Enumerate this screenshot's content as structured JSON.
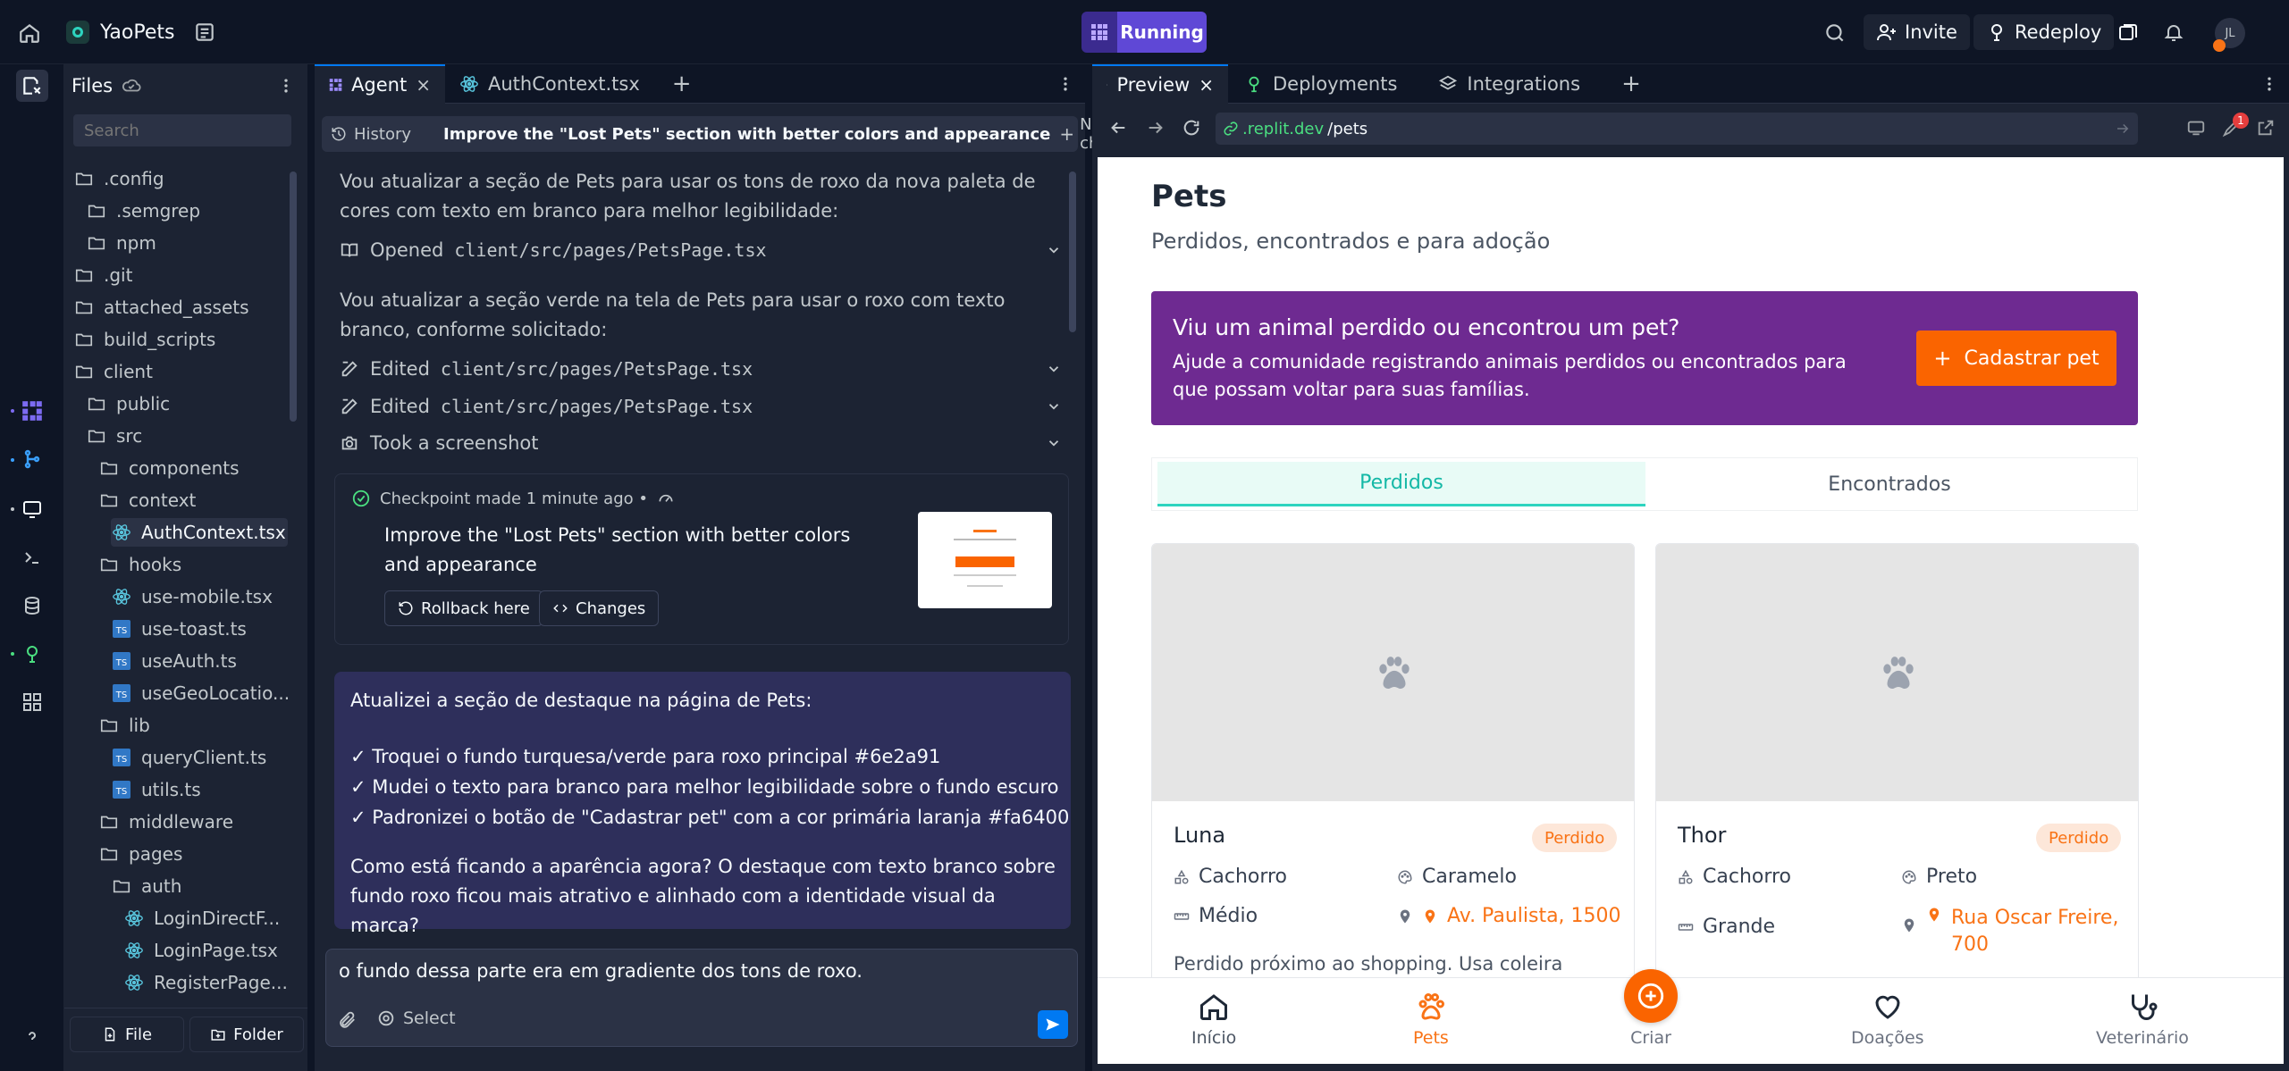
{
  "app": {
    "project_name": "YaoPets",
    "run_status": "Running",
    "invite_label": "Invite",
    "redeploy_label": "Redeploy",
    "avatar_initials": "JL"
  },
  "files": {
    "title": "Files",
    "search_placeholder": "Search",
    "items": [
      {
        "label": ".config"
      },
      {
        "label": ".semgrep"
      },
      {
        "label": "npm"
      },
      {
        "label": ".git"
      },
      {
        "label": "attached_assets"
      },
      {
        "label": "build_scripts"
      },
      {
        "label": "client"
      },
      {
        "label": "public"
      },
      {
        "label": "src"
      },
      {
        "label": "components"
      },
      {
        "label": "context"
      },
      {
        "label": "AuthContext.tsx"
      },
      {
        "label": "hooks"
      },
      {
        "label": "use-mobile.tsx"
      },
      {
        "label": "use-toast.ts"
      },
      {
        "label": "useAuth.ts"
      },
      {
        "label": "useGeoLocatio..."
      },
      {
        "label": "lib"
      },
      {
        "label": "queryClient.ts"
      },
      {
        "label": "utils.ts"
      },
      {
        "label": "middleware"
      },
      {
        "label": "pages"
      },
      {
        "label": "auth"
      },
      {
        "label": "LoginDirectF..."
      },
      {
        "label": "LoginPage.tsx"
      },
      {
        "label": "RegisterPage..."
      }
    ],
    "file_button": "File",
    "folder_button": "Folder"
  },
  "editor_tabs": {
    "agent": "Agent",
    "auth_context": "AuthContext.tsx"
  },
  "chat": {
    "history_label": "History",
    "title": "Improve the \"Lost Pets\" section with better colors and appearance",
    "new_chat_label": "New chat",
    "msg1": "Vou atualizar a seção de Pets para usar os tons de roxo da nova paleta de cores com texto em branco para melhor legibilidade:",
    "opened_label": "Opened",
    "opened_path": "client/src/pages/PetsPage.tsx",
    "msg2": "Vou atualizar a seção verde na tela de Pets para usar o roxo com texto branco, conforme solicitado:",
    "edited_label": "Edited",
    "edited_path": "client/src/pages/PetsPage.tsx",
    "screenshot_label": "Took a screenshot",
    "checkpoint_meta": "Checkpoint made 1 minute ago •",
    "checkpoint_title": "Improve the \"Lost Pets\" section with better colors and appearance",
    "rollback_label": "Rollback here",
    "changes_label": "Changes",
    "reply_intro": "Atualizei a seção de destaque na página de Pets:",
    "reply_items": [
      "✓ Troquei o fundo turquesa/verde para roxo principal #6e2a91",
      "✓ Mudei o texto para branco para melhor legibilidade sobre o fundo escuro",
      "✓ Padronizei o botão de \"Cadastrar pet\" com a cor primária laranja #fa6400"
    ],
    "reply_question": "Como está ficando a aparência agora? O destaque com texto branco sobre fundo roxo ficou mais atrativo e alinhado com a identidade visual da marca?",
    "input_value": "o fundo dessa parte era em gradiente dos tons de roxo.",
    "select_label": "Select"
  },
  "preview_tabs": {
    "preview": "Preview",
    "deployments": "Deployments",
    "integrations": "Integrations"
  },
  "url": {
    "domain": ".replit.dev",
    "path": "/pets"
  },
  "devtools_badge": "1",
  "page": {
    "title": "Pets",
    "subtitle": "Perdidos, encontrados e para adoção",
    "banner_title": "Viu um animal perdido ou encontrou um pet?",
    "banner_text": "Ajude a comunidade registrando animais perdidos ou encontrados para que possam voltar para suas famílias.",
    "banner_button": "Cadastrar pet",
    "tabs": [
      "Perdidos",
      "Encontrados"
    ],
    "pets": [
      {
        "name": "Luna",
        "status": "Perdido",
        "species": "Cachorro",
        "color": "Caramelo",
        "size": "Médio",
        "address": "Av. Paulista, 1500",
        "description": "Perdido próximo ao shopping. Usa coleira"
      },
      {
        "name": "Thor",
        "status": "Perdido",
        "species": "Cachorro",
        "color": "Preto",
        "size": "Grande",
        "address_line1": "Rua Oscar Freire,",
        "address_line2": "700"
      }
    ],
    "nav": [
      "Início",
      "Pets",
      "Criar",
      "Doações",
      "Veterinário"
    ]
  },
  "colors": {
    "purple": "#6e2a91",
    "orange": "#fa6400",
    "teal": "#2dd4bf",
    "dark_bg": "#0e1525",
    "panel_bg": "#1c2333",
    "running": "#5f48d6"
  }
}
